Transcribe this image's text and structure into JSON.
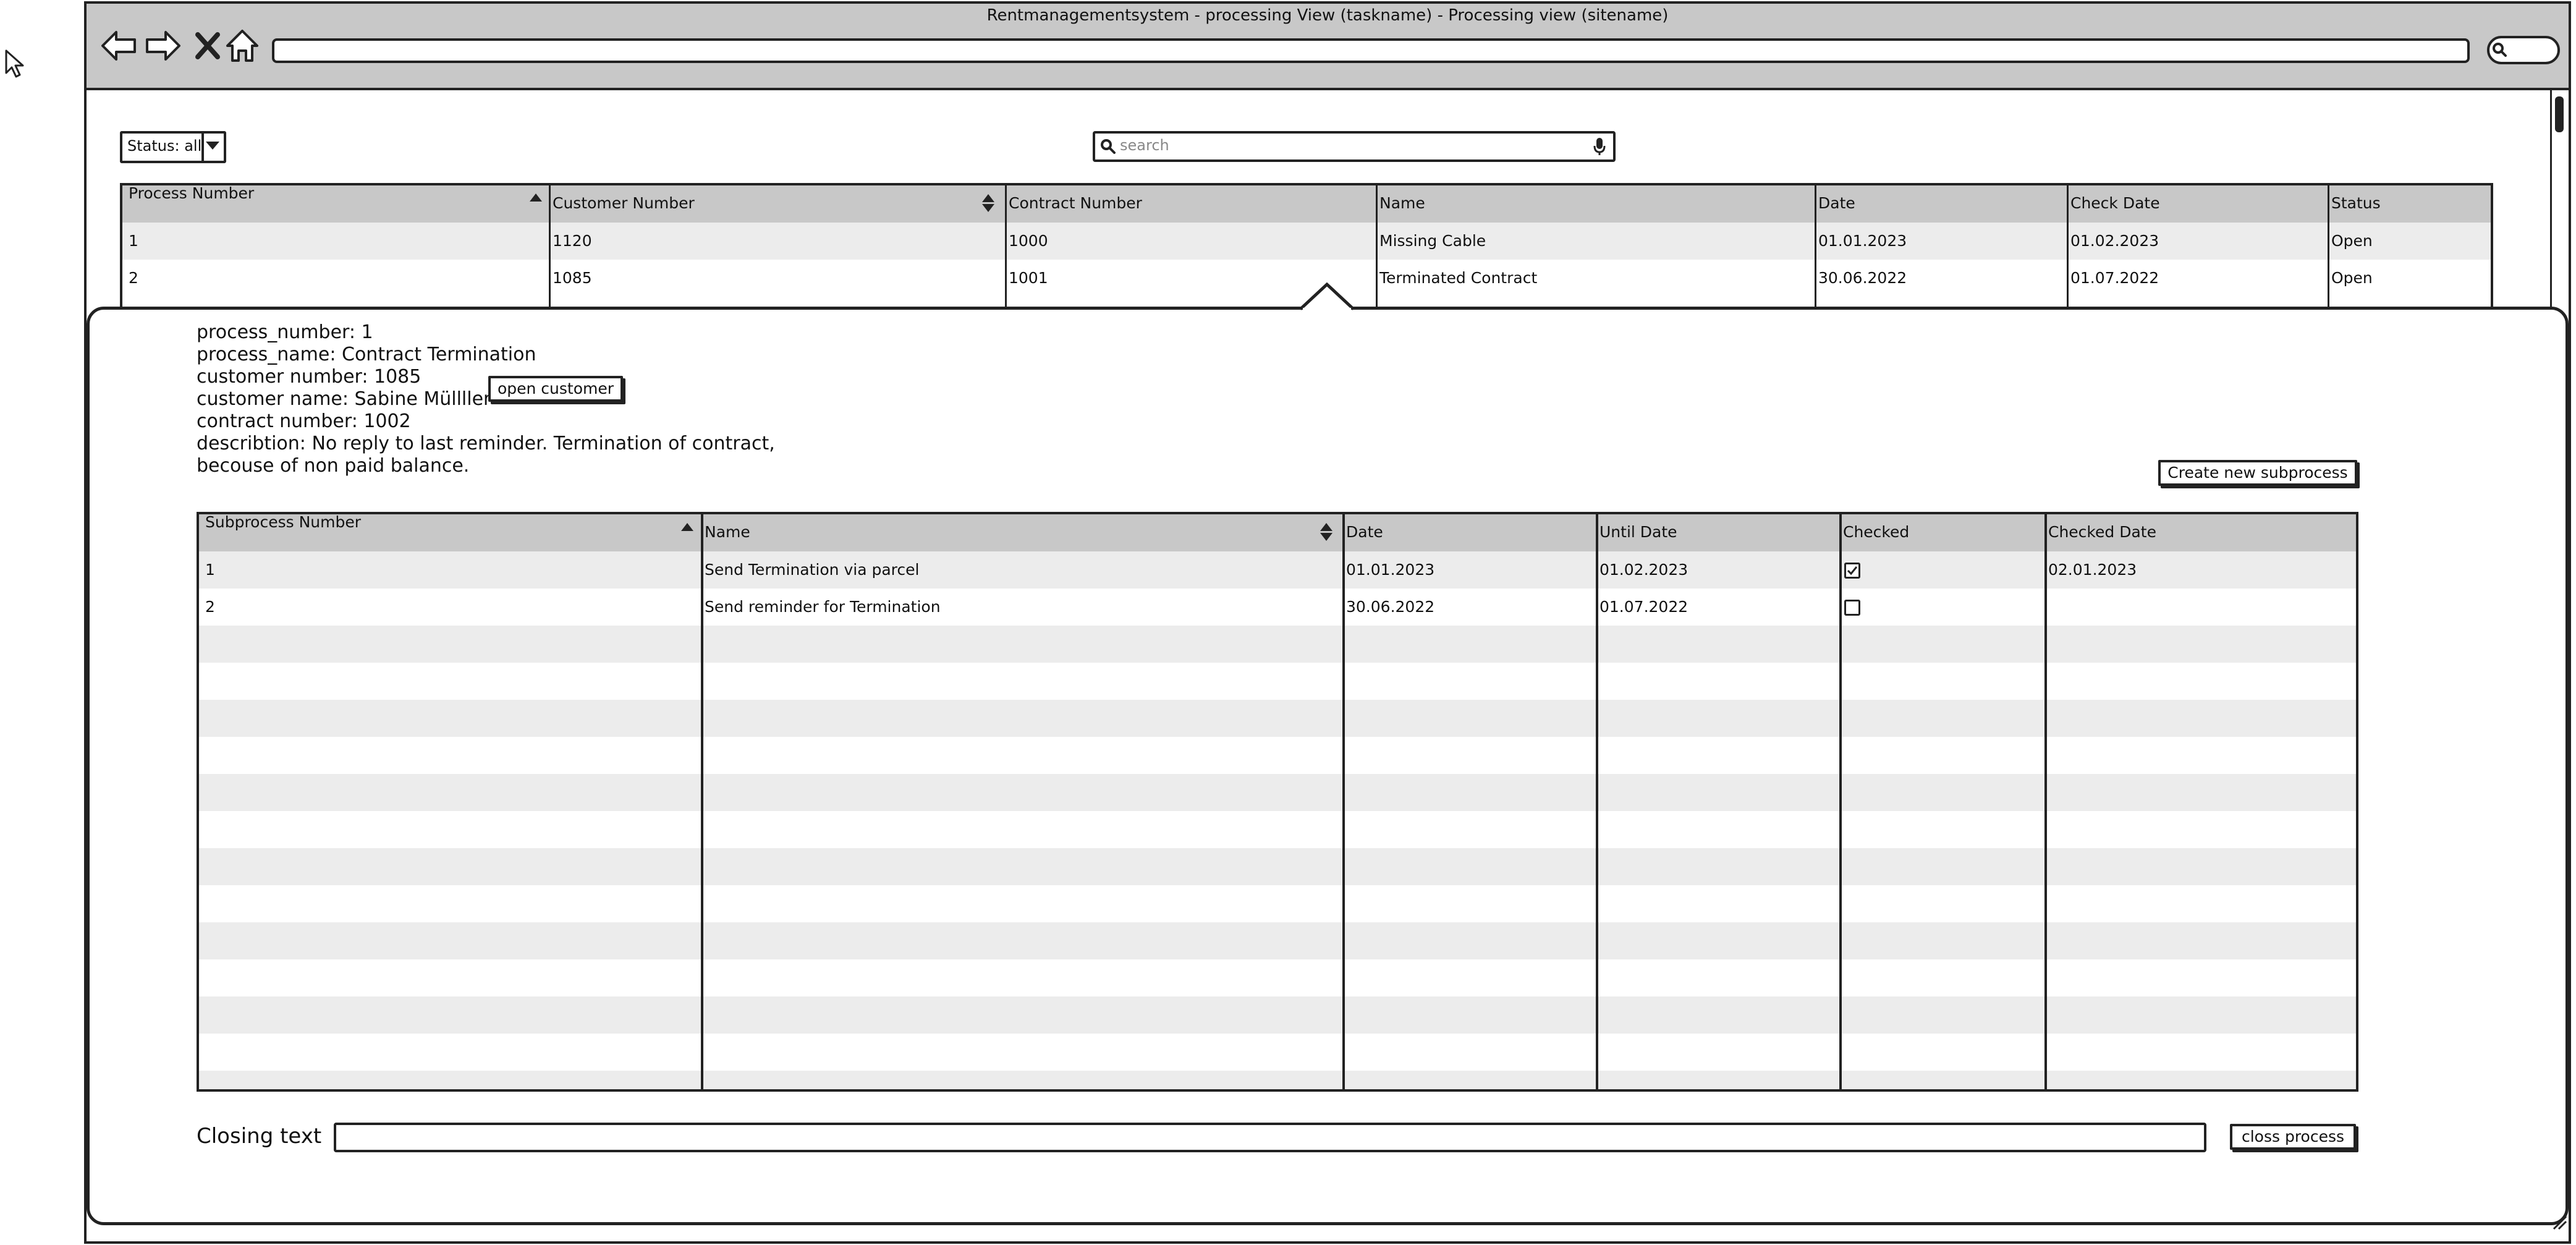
{
  "window": {
    "title": "Rentmanagementsystem - processing View (taskname) - Processing view (sitename)",
    "url": ""
  },
  "icons": {
    "back": "back-arrow-icon",
    "forward": "forward-arrow-icon",
    "stop": "close-icon",
    "home": "home-icon",
    "search": "search-icon",
    "mic": "microphone-icon",
    "cursor": "cursor-icon"
  },
  "filter": {
    "status_label": "Status: all"
  },
  "search": {
    "placeholder": "search"
  },
  "process_table": {
    "headers": [
      "Process Number",
      "Customer Number",
      "Contract Number",
      "Name",
      "Date",
      "Check Date",
      "Status"
    ],
    "rows": [
      [
        "1",
        "1120",
        "1000",
        "Missing Cable",
        "01.01.2023",
        "01.02.2023",
        "Open"
      ],
      [
        "2",
        "1085",
        "1001",
        "Terminated Contract",
        "30.06.2022",
        "01.07.2022",
        "Open"
      ]
    ]
  },
  "detail": {
    "lines": [
      "process_number: 1",
      "process_name: Contract Termination",
      "customer number: 1085",
      "customer name: Sabine Müllller",
      "contract number: 1002",
      "describtion: No reply to last reminder. Termination of contract,",
      "becouse of non paid balance."
    ],
    "open_customer_label": "open customer",
    "create_subprocess_label": "Create new subprocess"
  },
  "subprocess_table": {
    "headers": [
      "Subprocess Number",
      "Name",
      "Date",
      "Until Date",
      "Checked",
      "Checked Date"
    ],
    "rows": [
      [
        "1",
        "Send Termination via parcel",
        "01.01.2023",
        "01.02.2023",
        true,
        "02.01.2023"
      ],
      [
        "2",
        "Send reminder for Termination",
        "30.06.2022",
        "01.07.2022",
        false,
        ""
      ]
    ]
  },
  "closing": {
    "label": "Closing text",
    "value": "",
    "button_label": "closs process"
  },
  "colors": {
    "header_bg": "#c8c8c8",
    "stripe_bg": "#ececec",
    "border": "#222222"
  }
}
